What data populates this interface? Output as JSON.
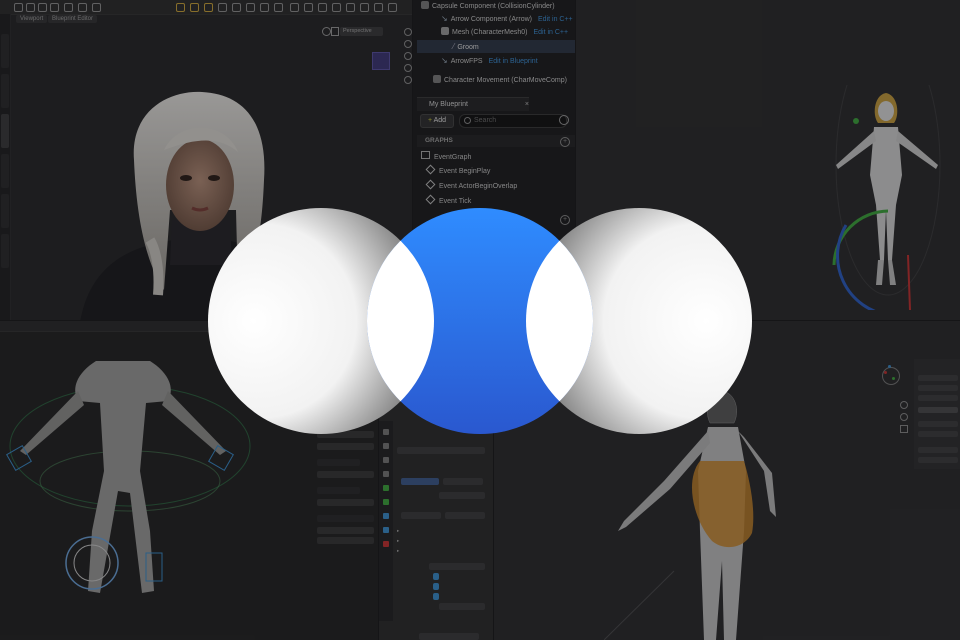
{
  "blueprint": {
    "components": [
      {
        "name": "Capsule Component (CollisionCylinder)",
        "link": ""
      },
      {
        "name": "Arrow Component (Arrow)",
        "link": "Edit in C++"
      },
      {
        "name": "Mesh (CharacterMesh0)",
        "link": "Edit in C++"
      },
      {
        "name": "Groom",
        "link": ""
      },
      {
        "name": "ArrowFPS",
        "link": "Edit in Blueprint"
      },
      {
        "name": "Character Movement (CharMoveComp)",
        "link": ""
      }
    ],
    "panel_tab": "My Blueprint",
    "add_label": "Add",
    "search_placeholder": "Search",
    "graphs_header": "GRAPHS",
    "event_graph": "EventGraph",
    "events": [
      "Event BeginPlay",
      "Event ActorBeginOverlap",
      "Event Tick"
    ]
  },
  "viewport_tl": {
    "tabs": [
      "Viewport",
      "Blueprint Editor"
    ],
    "perspective": "Perspective"
  },
  "colors": {
    "logo_blue": "#2e7cf6",
    "panel_bg": "#1d1d1e",
    "selection": "#2d3646",
    "link": "#3c8fd6",
    "outline_orange": "#e0892a"
  },
  "logo": {
    "name": "three overlapping spheres logo"
  }
}
